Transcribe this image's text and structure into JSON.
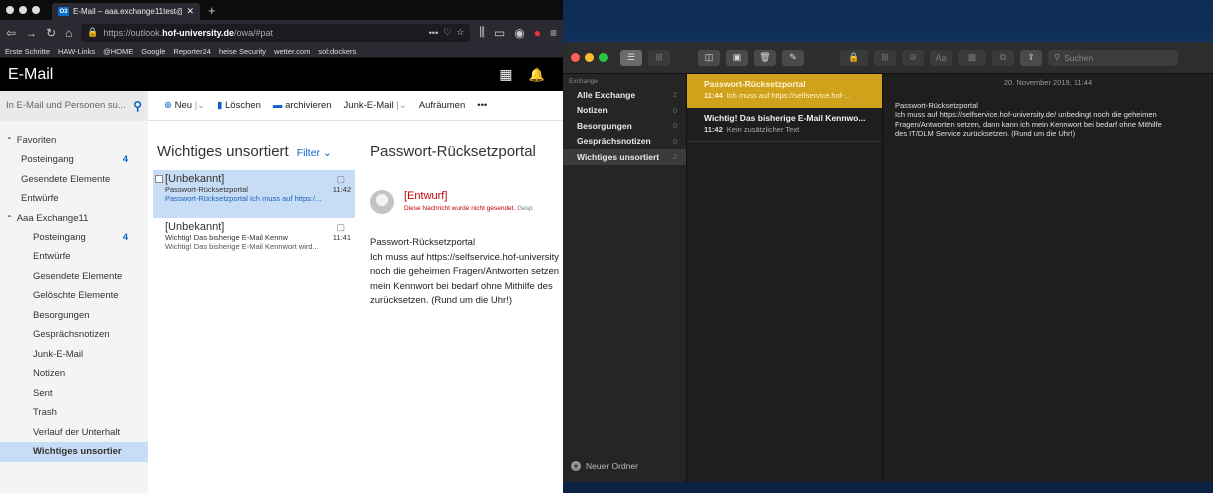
{
  "browser": {
    "tab_title": "E-Mail – aaa.exchange11test@",
    "tab_badge": "O3",
    "url_prefix": "https://outlook.",
    "url_host": "hof-university.de",
    "url_path": "/owa/#pat",
    "nav_more": "•••",
    "bookmarks": [
      "Erste Schritte",
      "HAW-Links",
      "@HOME",
      "Google",
      "Reporter24",
      "heise Security",
      "wetter.com",
      "sol:dockers"
    ]
  },
  "owa": {
    "app_title": "E-Mail",
    "search_placeholder": "In E-Mail und Personen su...",
    "commands": {
      "new": "Neu",
      "delete": "Löschen",
      "archive": "archivieren",
      "junk": "Junk-E-Mail",
      "sweep": "Aufräumen",
      "more": "•••"
    },
    "folders": {
      "favorites_header": "Favoriten",
      "favorites": [
        {
          "label": "Posteingang",
          "count": "4"
        },
        {
          "label": "Gesendete Elemente",
          "count": ""
        },
        {
          "label": "Entwürfe",
          "count": ""
        }
      ],
      "account_header": "Aaa Exchange11",
      "account": [
        {
          "label": "Posteingang",
          "count": "4"
        },
        {
          "label": "Entwürfe",
          "count": ""
        },
        {
          "label": "Gesendete Elemente",
          "count": ""
        },
        {
          "label": "Gelöschte Elemente",
          "count": ""
        },
        {
          "label": "Besorgungen",
          "count": ""
        },
        {
          "label": "Gesprächsnotizen",
          "count": ""
        },
        {
          "label": "Junk-E-Mail",
          "count": ""
        },
        {
          "label": "Notizen",
          "count": ""
        },
        {
          "label": "Sent",
          "count": ""
        },
        {
          "label": "Trash",
          "count": ""
        },
        {
          "label": "Verlauf der Unterhalt",
          "count": ""
        },
        {
          "label": "Wichtiges unsortier",
          "count": ""
        }
      ]
    },
    "list": {
      "title": "Wichtiges unsortiert",
      "filter": "Filter",
      "messages": [
        {
          "from": "[Unbekannt]",
          "subject": "Passwort-Rücksetzportal",
          "time": "11:42",
          "preview": "Passwort-Rücksetzportal Ich muss auf https:/..."
        },
        {
          "from": "[Unbekannt]",
          "subject": "Wichtig! Das bisherige E-Mail Kennw",
          "time": "11:41",
          "preview": "Wichtig! Das bisherige E-Mail Kennwort wird..."
        }
      ]
    },
    "reading": {
      "subject": "Passwort-Rücksetzportal",
      "sender": "[Entwurf]",
      "not_sent": "Diese Nachricht wurde nicht gesendet.",
      "not_sent_more": "Gesp",
      "body": [
        "Passwort-Rücksetzportal",
        "Ich muss auf https://selfservice.hof-university",
        "noch die geheimen Fragen/Antworten setzen",
        "mein Kennwort bei bedarf ohne Mithilfe des",
        "zurücksetzen. (Rund um die Uhr!)"
      ]
    }
  },
  "notes": {
    "search_placeholder": "Suchen",
    "account_label": "Exchange",
    "folders": [
      {
        "label": "Alle Exchange",
        "count": "2"
      },
      {
        "label": "Notizen",
        "count": "0"
      },
      {
        "label": "Besorgungen",
        "count": "0"
      },
      {
        "label": "Gesprächsnotizen",
        "count": "0"
      },
      {
        "label": "Wichtiges unsortiert",
        "count": "2"
      }
    ],
    "new_folder": "Neuer Ordner",
    "items": [
      {
        "title": "Passwort-Rücksetzportal",
        "time": "11:44",
        "preview": "Ich muss auf https://selfservice.hof-..."
      },
      {
        "title": "Wichtig! Das bisherige E-Mail Kennwo...",
        "time": "11:42",
        "preview": "Kein zusätzlicher Text"
      }
    ],
    "content": {
      "date": "20. November 2019, 11:44",
      "lines": [
        "Passwort-Rücksetzportal",
        "Ich muss auf https://selfservice.hof-university.de/ unbedingt noch die geheimen",
        "Fragen/Antworten setzen, dann kann ich mein Kennwort bei bedarf ohne Mithilfe",
        "des IT/DLM Service zurücksetzen. (Rund um die Uhr!)"
      ]
    }
  }
}
